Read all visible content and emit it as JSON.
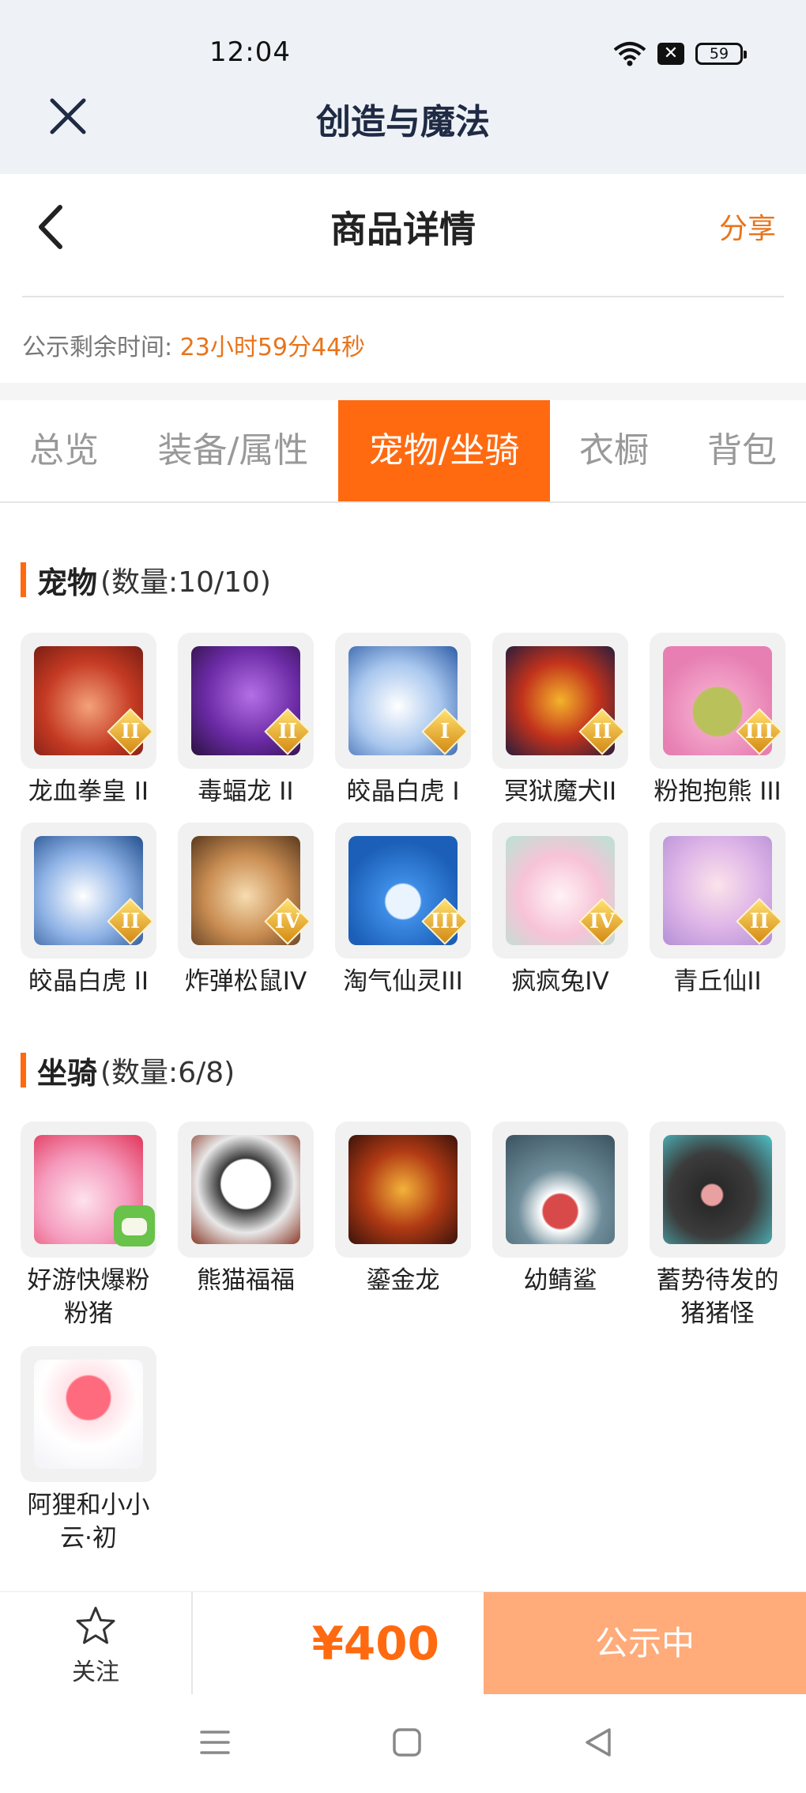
{
  "status_bar": {
    "time": "12:04",
    "battery": "59"
  },
  "app_bar": {
    "title": "创造与魔法"
  },
  "page": {
    "title": "商品详情",
    "share_label": "分享"
  },
  "notice": {
    "label": "公示剩余时间:",
    "countdown": "23小时59分44秒"
  },
  "tabs": [
    {
      "label": "总览",
      "active": false
    },
    {
      "label": "装备/属性",
      "active": false
    },
    {
      "label": "宠物/坐骑",
      "active": true
    },
    {
      "label": "衣橱",
      "active": false
    },
    {
      "label": "背包",
      "active": false
    }
  ],
  "pets": {
    "title": "宠物",
    "count": "(数量:10/10)",
    "items": [
      {
        "name": "龙血拳皇 II",
        "tier": "II",
        "icon": "red-ram-beast"
      },
      {
        "name": "毒蝠龙 II",
        "tier": "II",
        "icon": "purple-bat-dragon"
      },
      {
        "name": "皎晶白虎 I",
        "tier": "I",
        "icon": "white-crystal-tiger"
      },
      {
        "name": "冥狱魔犬II",
        "tier": "II",
        "icon": "hell-dog"
      },
      {
        "name": "粉抱抱熊 III",
        "tier": "III",
        "icon": "pink-hug-bear"
      },
      {
        "name": "皎晶白虎 II",
        "tier": "II",
        "icon": "white-crystal-tiger"
      },
      {
        "name": "炸弹松鼠IV",
        "tier": "IV",
        "icon": "bomb-squirrel"
      },
      {
        "name": "淘气仙灵III",
        "tier": "III",
        "icon": "blue-sprite"
      },
      {
        "name": "疯疯兔IV",
        "tier": "IV",
        "icon": "crazy-rabbit"
      },
      {
        "name": "青丘仙II",
        "tier": "II",
        "icon": "fox-fairy"
      }
    ]
  },
  "mounts": {
    "title": "坐骑",
    "count": "(数量:6/8)",
    "items": [
      {
        "name": "好游快爆粉粉猪",
        "icon": "pink-pig-balloon",
        "badge": "face"
      },
      {
        "name": "熊猫福福",
        "icon": "panda"
      },
      {
        "name": "鎏金龙",
        "icon": "golden-dragon"
      },
      {
        "name": "幼鲭鲨",
        "icon": "young-shark"
      },
      {
        "name": "蓄势待发的猪猪怪",
        "icon": "black-pig-monster"
      },
      {
        "name": "阿狸和小小云·初",
        "icon": "ali-and-cloud"
      }
    ]
  },
  "bottom_bar": {
    "follow_label": "关注",
    "price": "¥400",
    "status_label": "公示中"
  },
  "colors": {
    "accent": "#ff6a10",
    "countdown": "#e8741c",
    "status_button": "#ffab7a"
  }
}
